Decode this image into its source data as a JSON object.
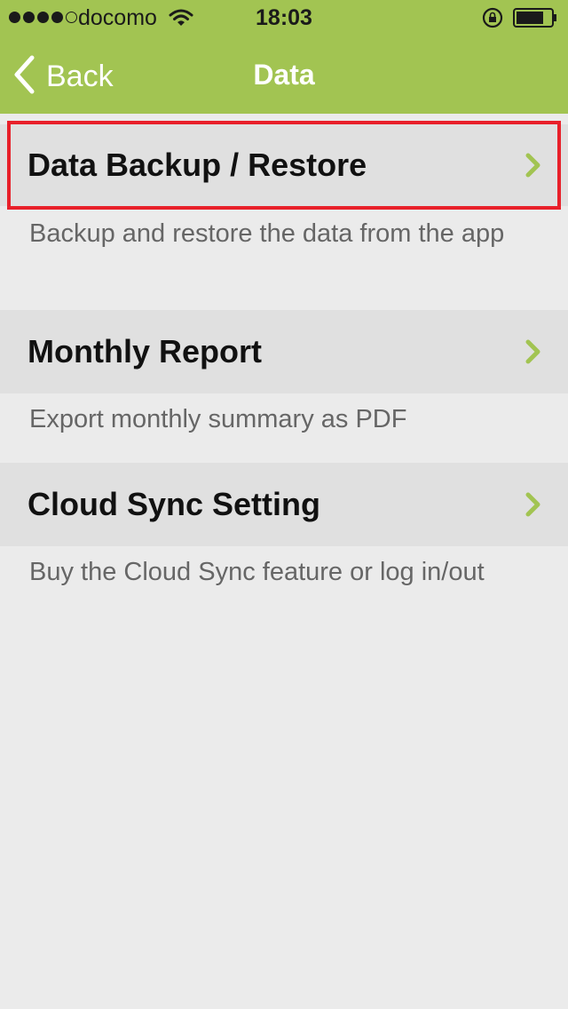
{
  "status_bar": {
    "carrier": "docomo",
    "time": "18:03",
    "signal_dots_filled": 4,
    "signal_dots_total": 5
  },
  "nav": {
    "back_label": "Back",
    "title": "Data"
  },
  "items": [
    {
      "label": "Data Backup / Restore",
      "description": "Backup and restore the data from the app",
      "highlighted": true
    },
    {
      "label": "Monthly Report",
      "description": "Export monthly summary as PDF",
      "highlighted": false
    },
    {
      "label": "Cloud Sync Setting",
      "description": "Buy the Cloud Sync feature or log in/out",
      "highlighted": false
    }
  ],
  "icons": {
    "back": "chevron-left-icon",
    "disclosure": "chevron-right-icon",
    "wifi": "wifi-icon",
    "orientation_lock": "orientation-lock-icon",
    "battery": "battery-icon"
  },
  "colors": {
    "header": "#a2c452",
    "accent": "#a2c452",
    "highlight_border": "#e8202a",
    "background": "#ebebeb",
    "row": "#e0e0e0"
  }
}
